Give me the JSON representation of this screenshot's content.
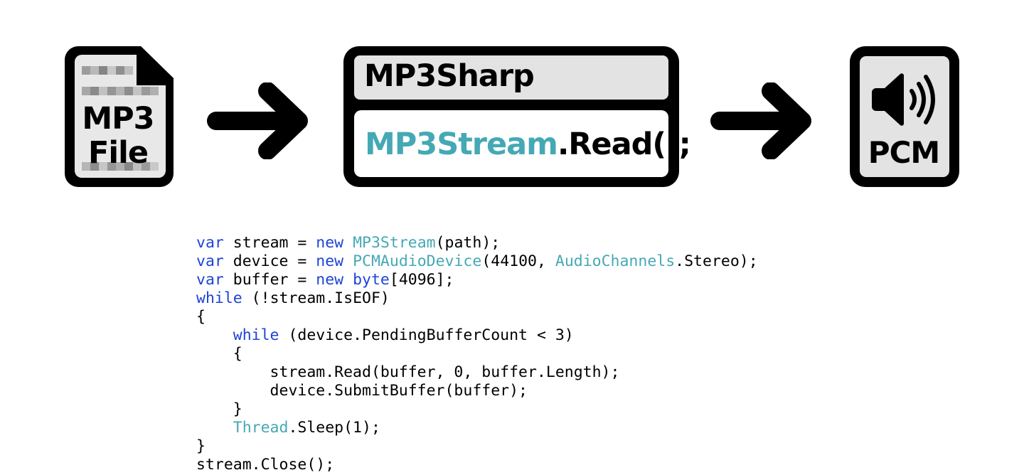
{
  "diagram": {
    "input": {
      "line1": "MP3",
      "line2": "File",
      "icon": "file-icon"
    },
    "library": {
      "title": "MP3Sharp",
      "call_class": "MP3Stream",
      "call_method": ".Read();"
    },
    "output": {
      "label": "PCM",
      "icon": "speaker-icon"
    },
    "arrow_icon": "arrow-right-icon"
  },
  "code": {
    "lines": [
      [
        {
          "k": "kw",
          "t": "var"
        },
        {
          "k": "",
          "t": " stream = "
        },
        {
          "k": "kw",
          "t": "new"
        },
        {
          "k": "",
          "t": " "
        },
        {
          "k": "ty",
          "t": "MP3Stream"
        },
        {
          "k": "",
          "t": "(path);"
        }
      ],
      [
        {
          "k": "kw",
          "t": "var"
        },
        {
          "k": "",
          "t": " device = "
        },
        {
          "k": "kw",
          "t": "new"
        },
        {
          "k": "",
          "t": " "
        },
        {
          "k": "ty",
          "t": "PCMAudioDevice"
        },
        {
          "k": "",
          "t": "(44100, "
        },
        {
          "k": "ty",
          "t": "AudioChannels"
        },
        {
          "k": "",
          "t": ".Stereo);"
        }
      ],
      [
        {
          "k": "kw",
          "t": "var"
        },
        {
          "k": "",
          "t": " buffer = "
        },
        {
          "k": "kw",
          "t": "new"
        },
        {
          "k": "",
          "t": " "
        },
        {
          "k": "kw",
          "t": "byte"
        },
        {
          "k": "",
          "t": "[4096];"
        }
      ],
      [
        {
          "k": "kw",
          "t": "while"
        },
        {
          "k": "",
          "t": " (!stream.IsEOF)"
        }
      ],
      [
        {
          "k": "",
          "t": "{"
        }
      ],
      [
        {
          "k": "",
          "t": "    "
        },
        {
          "k": "kw",
          "t": "while"
        },
        {
          "k": "",
          "t": " (device.PendingBufferCount < 3)"
        }
      ],
      [
        {
          "k": "",
          "t": "    {"
        }
      ],
      [
        {
          "k": "",
          "t": "        stream.Read(buffer, 0, buffer.Length);"
        }
      ],
      [
        {
          "k": "",
          "t": "        device.SubmitBuffer(buffer);"
        }
      ],
      [
        {
          "k": "",
          "t": "    }"
        }
      ],
      [
        {
          "k": "",
          "t": "    "
        },
        {
          "k": "ty",
          "t": "Thread"
        },
        {
          "k": "",
          "t": ".Sleep(1);"
        }
      ],
      [
        {
          "k": "",
          "t": "}"
        }
      ],
      [
        {
          "k": "",
          "t": "stream.Close();"
        }
      ]
    ]
  },
  "colors": {
    "keyword": "#1e44d6",
    "type": "#45a9b5",
    "panel": "#e3e3e3",
    "outline": "#000000"
  }
}
